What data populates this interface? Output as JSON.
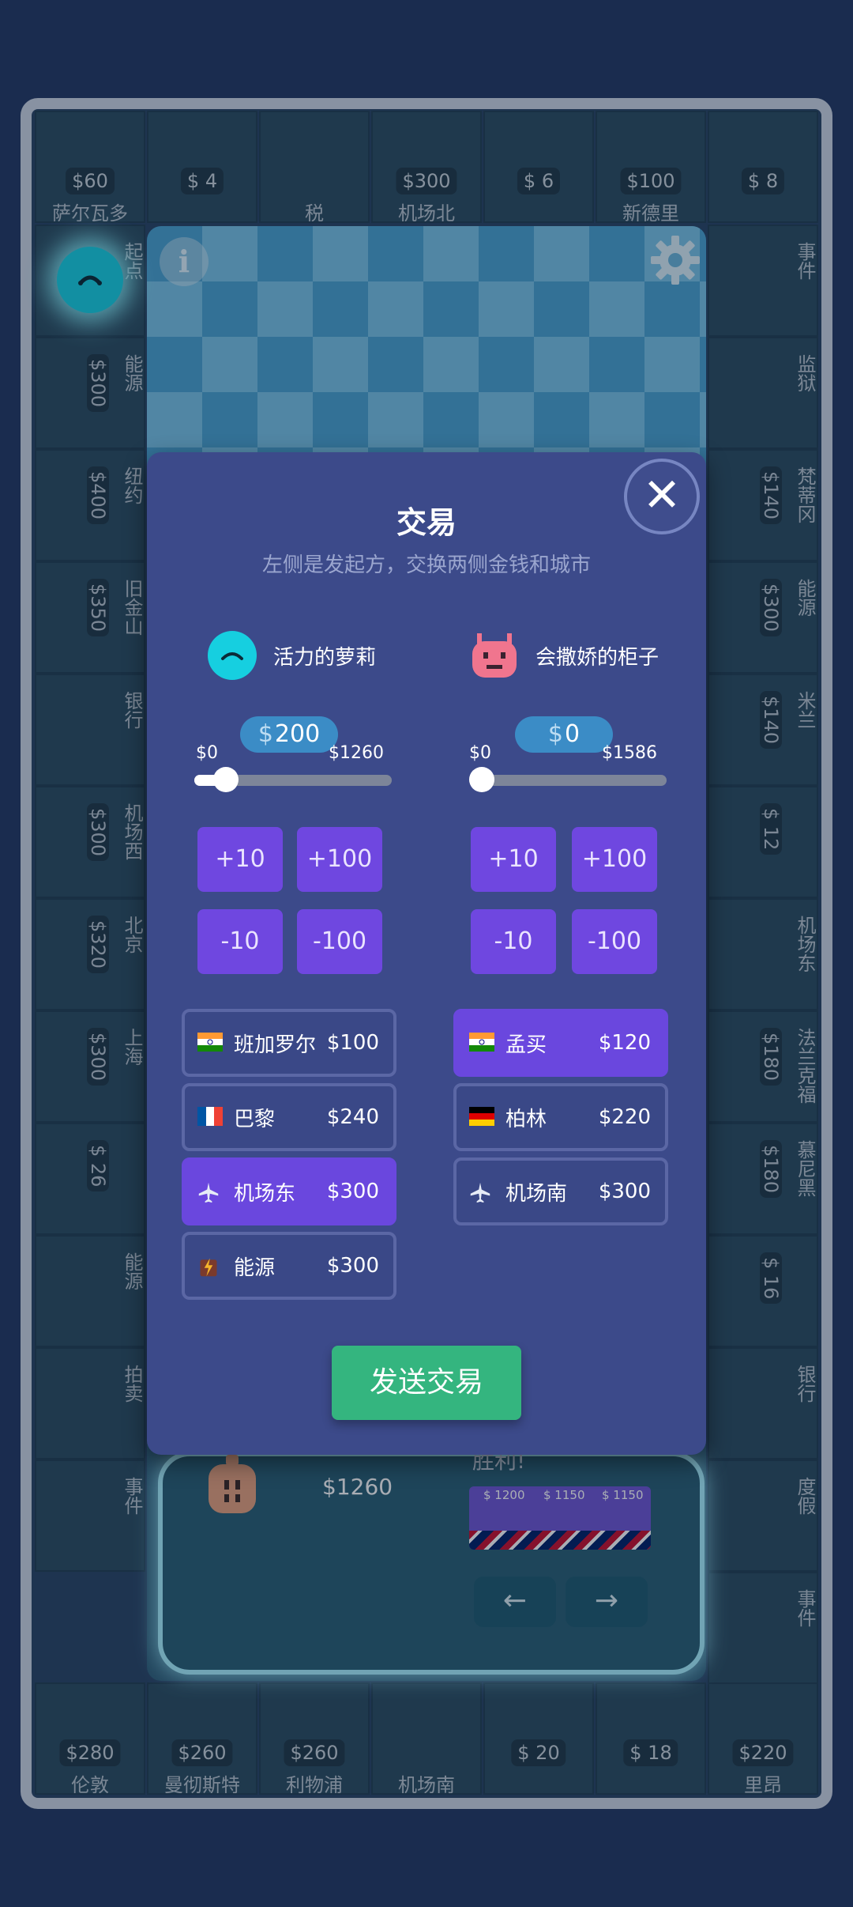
{
  "board": {
    "top_row": [
      {
        "name": "萨尔瓦多",
        "price": "$60"
      },
      {
        "name": "",
        "price": "$ 4"
      },
      {
        "name": "税",
        "price": ""
      },
      {
        "name": "机场北",
        "price": "$300"
      },
      {
        "name": "",
        "price": "$ 6"
      },
      {
        "name": "新德里",
        "price": "$100"
      },
      {
        "name": "",
        "price": "$ 8"
      }
    ],
    "left_col": [
      {
        "name": "起点",
        "price": ""
      },
      {
        "name": "能源",
        "price": "$300"
      },
      {
        "name": "纽约",
        "price": "$400"
      },
      {
        "name": "旧金山",
        "price": "$350"
      },
      {
        "name": "银行",
        "price": ""
      },
      {
        "name": "机场西",
        "price": "$300"
      },
      {
        "name": "北京",
        "price": "$320"
      },
      {
        "name": "上海",
        "price": "$300"
      },
      {
        "name": "",
        "price": "$ 26"
      },
      {
        "name": "能源",
        "price": ""
      },
      {
        "name": "拍卖",
        "price": ""
      },
      {
        "name": "事件",
        "price": ""
      }
    ],
    "right_col": [
      {
        "name": "事件",
        "price": ""
      },
      {
        "name": "监狱",
        "price": ""
      },
      {
        "name": "梵蒂冈",
        "price": "$140"
      },
      {
        "name": "能源",
        "price": "$300"
      },
      {
        "name": "米兰",
        "price": "$140"
      },
      {
        "name": "",
        "price": "$ 12"
      },
      {
        "name": "机场东",
        "price": ""
      },
      {
        "name": "法兰克福",
        "price": "$180"
      },
      {
        "name": "慕尼黑",
        "price": "$180"
      },
      {
        "name": "",
        "price": "$ 16"
      },
      {
        "name": "银行",
        "price": ""
      },
      {
        "name": "度假",
        "price": ""
      },
      {
        "name": "事件",
        "price": ""
      }
    ],
    "bottom_row": [
      {
        "name": "伦敦",
        "price": "$280"
      },
      {
        "name": "曼彻斯特",
        "price": "$260"
      },
      {
        "name": "利物浦",
        "price": "$260"
      },
      {
        "name": "机场南",
        "price": ""
      },
      {
        "name": "",
        "price": "$ 20"
      },
      {
        "name": "",
        "price": "$ 18"
      },
      {
        "name": "里昂",
        "price": "$220"
      }
    ]
  },
  "background_card": {
    "amount": "$1260",
    "label": "胜利!",
    "mini_prices": [
      "$ 1200",
      "$ 1150",
      "$ 1150"
    ],
    "prev_arrow": "←",
    "next_arrow": "→"
  },
  "dialog": {
    "close_glyph": "✕",
    "title": "交易",
    "subtitle": "左侧是发起方，交换两侧金钱和城市",
    "left": {
      "player_name": "活力的萝莉",
      "money_symbol": "$",
      "money_value": "200",
      "range_min": "$0",
      "range_max": "$1260",
      "slider_fraction": 0.159,
      "buttons": [
        "+10",
        "+100",
        "-10",
        "-100"
      ],
      "properties": [
        {
          "icon": "india-flag-icon",
          "name": "班加罗尔",
          "price": "$100",
          "selected": false
        },
        {
          "icon": "france-flag-icon",
          "name": "巴黎",
          "price": "$240",
          "selected": false
        },
        {
          "icon": "airplane-icon",
          "name": "机场东",
          "price": "$300",
          "selected": true
        },
        {
          "icon": "energy-icon",
          "name": "能源",
          "price": "$300",
          "selected": false
        }
      ]
    },
    "right": {
      "player_name": "会撒娇的柜子",
      "money_symbol": "$",
      "money_value": "0",
      "range_min": "$0",
      "range_max": "$1586",
      "slider_fraction": 0,
      "buttons": [
        "+10",
        "+100",
        "-10",
        "-100"
      ],
      "properties": [
        {
          "icon": "india-flag-icon",
          "name": "孟买",
          "price": "$120",
          "selected": true
        },
        {
          "icon": "germany-flag-icon",
          "name": "柏林",
          "price": "$220",
          "selected": false
        },
        {
          "icon": "airplane-icon",
          "name": "机场南",
          "price": "$300",
          "selected": false
        }
      ]
    },
    "send_label": "发送交易"
  },
  "colors": {
    "accent_purple": "#6f47e0",
    "send_green": "#34b57f",
    "dialog_bg": "#3c4a8a",
    "chip_blue": "#3b8cc6"
  }
}
